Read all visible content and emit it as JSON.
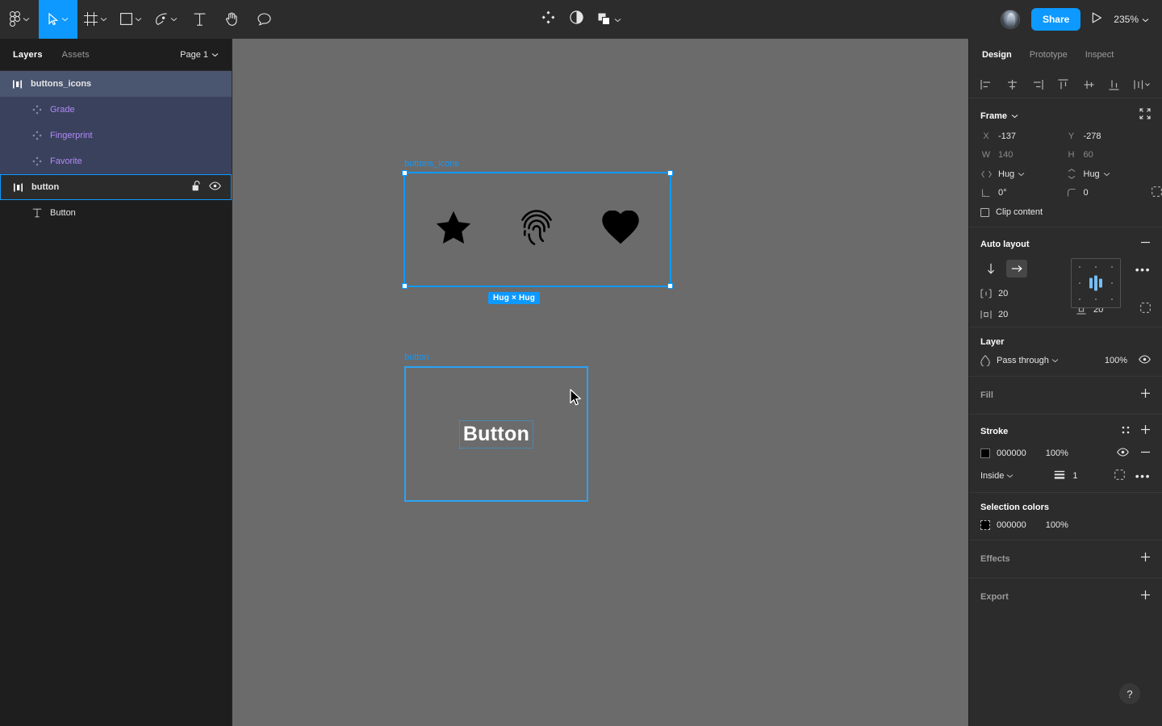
{
  "toolbar": {
    "menu_icon": "figma-logo-icon",
    "tools": [
      {
        "name": "move-tool",
        "icon": "cursor-icon",
        "active": true,
        "has_caret": true
      },
      {
        "name": "frame-tool",
        "icon": "frame-icon",
        "active": false,
        "has_caret": true
      },
      {
        "name": "shape-tool",
        "icon": "square-icon",
        "active": false,
        "has_caret": true
      },
      {
        "name": "pen-tool",
        "icon": "pen-icon",
        "active": false,
        "has_caret": true
      },
      {
        "name": "text-tool",
        "icon": "text-icon",
        "active": false,
        "has_caret": false
      },
      {
        "name": "hand-tool",
        "icon": "hand-icon",
        "active": false,
        "has_caret": false
      },
      {
        "name": "comment-tool",
        "icon": "comment-icon",
        "active": false,
        "has_caret": false
      }
    ],
    "center_tools": [
      {
        "name": "components-tool",
        "icon": "components-icon"
      },
      {
        "name": "mask-tool",
        "icon": "mask-icon"
      },
      {
        "name": "boolean-tool",
        "icon": "boolean-icon",
        "has_caret": true
      }
    ],
    "avatar_label": "user-avatar",
    "share_label": "Share",
    "present_icon": "play-icon",
    "zoom_label": "235%"
  },
  "left_panel": {
    "tabs": [
      {
        "label": "Layers",
        "active": true
      },
      {
        "label": "Assets",
        "active": false
      }
    ],
    "page_label": "Page 1",
    "layers": [
      {
        "label": "buttons_icons",
        "icon": "auto-layout-horizontal-icon",
        "state": "frame-sel",
        "indent": 0
      },
      {
        "label": "Grade",
        "icon": "component-icon",
        "state": "child-sel",
        "indent": 1
      },
      {
        "label": "Fingerprint",
        "icon": "component-icon",
        "state": "child-sel",
        "indent": 1
      },
      {
        "label": "Favorite",
        "icon": "component-icon",
        "state": "child-sel",
        "indent": 1
      },
      {
        "label": "button",
        "icon": "auto-layout-horizontal-icon",
        "state": "outlined",
        "indent": 0,
        "actions": [
          "unlock-icon",
          "eye-icon"
        ]
      },
      {
        "label": "Button",
        "icon": "text-layer-icon",
        "state": "none",
        "indent": 1
      }
    ]
  },
  "canvas": {
    "background_color": "#6b6b6b",
    "frames": [
      {
        "label": "buttons_icons",
        "selected": true,
        "size_badge": "Hug × Hug",
        "children": [
          "star-icon",
          "fingerprint-icon",
          "heart-icon"
        ]
      },
      {
        "label": "button",
        "selected": false,
        "text": "Button"
      }
    ],
    "cursor": "pointer-cursor"
  },
  "right_panel": {
    "tabs": [
      {
        "label": "Design",
        "active": true
      },
      {
        "label": "Prototype",
        "active": false
      },
      {
        "label": "Inspect",
        "active": false
      }
    ],
    "align_icons": [
      "align-left-icon",
      "align-horizontal-center-icon",
      "align-right-icon",
      "align-top-icon",
      "align-vertical-center-icon",
      "align-bottom-icon",
      "distribute-icon"
    ],
    "frame": {
      "title": "Frame",
      "resize_icon": "resize-to-fit-icon",
      "x_label": "X",
      "x_value": "-137",
      "y_label": "Y",
      "y_value": "-278",
      "w_label": "W",
      "w_value": "140",
      "h_label": "H",
      "h_value": "60",
      "hug_h_label": "Hug",
      "hug_v_label": "Hug",
      "rotation_value": "0°",
      "corner_radius_value": "0",
      "independent_corners_icon": "independent-corners-icon",
      "clip_content_label": "Clip content",
      "clip_content_checked": false
    },
    "auto_layout": {
      "title": "Auto layout",
      "remove_icon": "minus-icon",
      "direction_vertical_icon": "arrow-down-icon",
      "direction_horizontal_icon": "arrow-right-icon",
      "direction_active": "horizontal",
      "gap_label": "item-spacing-icon",
      "gap_value": "20",
      "padding_h_icon": "horizontal-padding-icon",
      "padding_h_value": "20",
      "padding_v_icon": "vertical-padding-icon",
      "padding_v_value": "20",
      "individual_padding_icon": "individual-padding-icon",
      "more_icon": "more-options-icon",
      "alignment": "center"
    },
    "layer": {
      "title": "Layer",
      "blend_icon": "blend-mode-icon",
      "blend_mode": "Pass through",
      "opacity": "100%",
      "visibility_icon": "eye-icon"
    },
    "fill": {
      "title": "Fill",
      "add_icon": "plus-icon"
    },
    "stroke": {
      "title": "Stroke",
      "styles_icon": "stroke-styles-icon",
      "add_icon": "plus-icon",
      "color_hex": "000000",
      "opacity": "100%",
      "visibility_icon": "eye-icon",
      "remove_icon": "minus-icon",
      "position": "Inside",
      "weight_icon": "stroke-weight-icon",
      "weight_value": "1",
      "advanced_icon": "advanced-stroke-icon",
      "more_icon": "more-options-icon"
    },
    "selection_colors": {
      "title": "Selection colors",
      "color_hex": "000000",
      "opacity": "100%"
    },
    "effects": {
      "title": "Effects",
      "add_icon": "plus-icon"
    },
    "export": {
      "title": "Export",
      "add_icon": "plus-icon"
    },
    "help_label": "?"
  },
  "colors": {
    "accent": "#0d99ff",
    "panel_bg": "#2c2c2c",
    "left_bg": "#1e1e1e",
    "canvas_bg": "#6b6b6b",
    "selection_row": "#4a5570",
    "component_purple": "#b389f9"
  }
}
